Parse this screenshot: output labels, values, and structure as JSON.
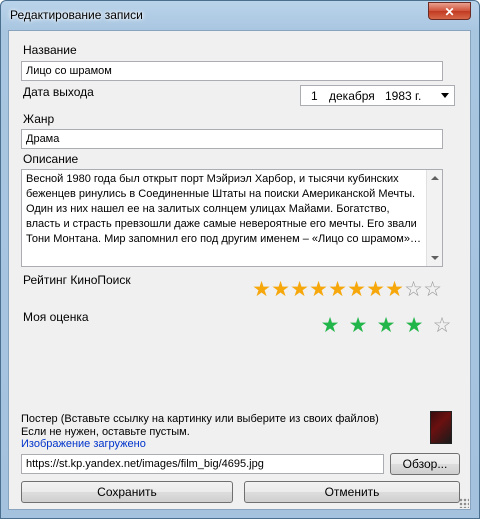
{
  "window": {
    "title": "Редактирование записи",
    "close_symbol": "✕"
  },
  "form": {
    "name_label": "Название",
    "name_value": "Лицо со шрамом",
    "release_label": "Дата выхода",
    "release_day": "1",
    "release_month": "декабря",
    "release_year": "1983 г.",
    "genre_label": "Жанр",
    "genre_value": "Драма",
    "description_label": "Описание",
    "description_value": "Весной 1980 года был открыт порт Мэйриэл Харбор, и тысячи кубинских беженцев ринулись в Соединенные Штаты на поиски Американской Мечты. Один из них нашел ее на залитых солнцем улицах Майами. Богатство, власть и страсть превзошли даже самые невероятные его мечты. Его звали Тони Монтана. Мир запомнил его под другим именем – «Лицо со шрамом»…",
    "kp_rating_label": "Рейтинг КиноПоиск",
    "kp_rating": 8,
    "kp_rating_max": 10,
    "my_rating_label": "Моя оценка",
    "my_rating": 4,
    "my_rating_max": 5
  },
  "poster": {
    "hint_line1": "Постер (Вставьте ссылку на картинку или выберите из своих файлов)",
    "hint_line2": "Если не нужен, оставьте пустым.",
    "status": "Изображение загружено",
    "url_value": "https://st.kp.yandex.net/images/film_big/4695.jpg",
    "browse_label": "Обзор..."
  },
  "buttons": {
    "save_label": "Сохранить",
    "cancel_label": "Отменить"
  },
  "colors": {
    "star_gold": "#f5a70c",
    "star_green": "#22b54a",
    "link": "#0033cc"
  },
  "icons": [
    "window-icon",
    "close-icon",
    "dropdown-arrow-icon",
    "scroll-up-icon",
    "scroll-down-icon",
    "star-icon",
    "poster-thumbnail",
    "resize-grip-icon"
  ]
}
